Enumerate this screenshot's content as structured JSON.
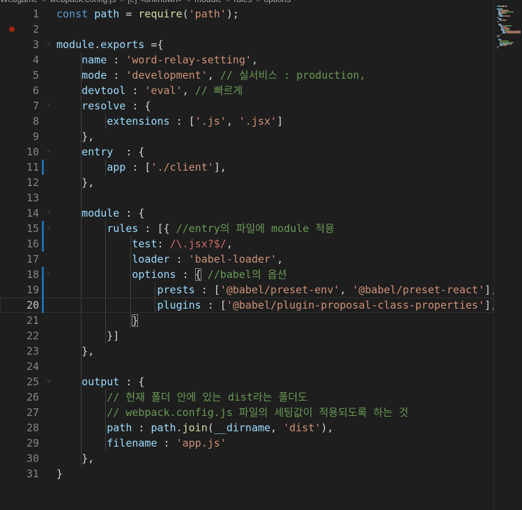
{
  "breadcrumb": {
    "items": [
      "Webgame",
      "webpack.config.js",
      "[e] <unknown>",
      "module",
      "rules",
      "options"
    ],
    "separator": ">"
  },
  "editor": {
    "language": "javascript",
    "active_line": "20",
    "breakpoint_line": "2",
    "lines": [
      {
        "n": "1",
        "tokens": [
          [
            "kw",
            "const"
          ],
          [
            "pun",
            " "
          ],
          [
            "var",
            "path"
          ],
          [
            "pun",
            " = "
          ],
          [
            "fn",
            "require"
          ],
          [
            "pun",
            "("
          ],
          [
            "str",
            "'path'"
          ],
          [
            "pun",
            ");"
          ]
        ]
      },
      {
        "n": "2",
        "tokens": []
      },
      {
        "n": "3",
        "tokens": [
          [
            "var",
            "module"
          ],
          [
            "pun",
            "."
          ],
          [
            "var",
            "exports"
          ],
          [
            "pun",
            " ={"
          ]
        ]
      },
      {
        "n": "4",
        "tokens": [
          [
            "pun",
            "    "
          ],
          [
            "var",
            "name"
          ],
          [
            "pun",
            " : "
          ],
          [
            "str",
            "'word-relay-setting'"
          ],
          [
            "pun",
            ","
          ]
        ]
      },
      {
        "n": "5",
        "tokens": [
          [
            "pun",
            "    "
          ],
          [
            "var",
            "mode"
          ],
          [
            "pun",
            " : "
          ],
          [
            "str",
            "'development'"
          ],
          [
            "pun",
            ", "
          ],
          [
            "com",
            "// 실서비스 : production,"
          ]
        ]
      },
      {
        "n": "6",
        "tokens": [
          [
            "pun",
            "    "
          ],
          [
            "var",
            "devtool"
          ],
          [
            "pun",
            " : "
          ],
          [
            "str",
            "'eval'"
          ],
          [
            "pun",
            ", "
          ],
          [
            "com",
            "// 빠르게"
          ]
        ]
      },
      {
        "n": "7",
        "tokens": [
          [
            "pun",
            "    "
          ],
          [
            "var",
            "resolve"
          ],
          [
            "pun",
            " : {"
          ]
        ]
      },
      {
        "n": "8",
        "tokens": [
          [
            "pun",
            "        "
          ],
          [
            "var",
            "extensions"
          ],
          [
            "pun",
            " : ["
          ],
          [
            "str",
            "'.js'"
          ],
          [
            "pun",
            ", "
          ],
          [
            "str",
            "'.jsx'"
          ],
          [
            "pun",
            "]"
          ]
        ]
      },
      {
        "n": "9",
        "tokens": [
          [
            "pun",
            "    },"
          ]
        ]
      },
      {
        "n": "10",
        "tokens": [
          [
            "pun",
            "    "
          ],
          [
            "var",
            "entry"
          ],
          [
            "pun",
            "  : {"
          ]
        ]
      },
      {
        "n": "11",
        "tokens": [
          [
            "pun",
            "        "
          ],
          [
            "var",
            "app"
          ],
          [
            "pun",
            " : ["
          ],
          [
            "str",
            "'./client'"
          ],
          [
            "pun",
            "],"
          ]
        ]
      },
      {
        "n": "12",
        "tokens": [
          [
            "pun",
            "    },"
          ]
        ]
      },
      {
        "n": "13",
        "tokens": []
      },
      {
        "n": "14",
        "tokens": [
          [
            "pun",
            "    "
          ],
          [
            "var",
            "module"
          ],
          [
            "pun",
            " : {"
          ]
        ]
      },
      {
        "n": "15",
        "tokens": [
          [
            "pun",
            "        "
          ],
          [
            "var",
            "rules"
          ],
          [
            "pun",
            " : [{ "
          ],
          [
            "com",
            "//entry의 파일에 module 적용"
          ]
        ]
      },
      {
        "n": "16",
        "tokens": [
          [
            "pun",
            "            "
          ],
          [
            "var",
            "test"
          ],
          [
            "pun",
            ": "
          ],
          [
            "re",
            "/\\.jsx?$/"
          ],
          [
            "pun",
            ","
          ]
        ]
      },
      {
        "n": "17",
        "tokens": [
          [
            "pun",
            "            "
          ],
          [
            "var",
            "loader"
          ],
          [
            "pun",
            " : "
          ],
          [
            "str",
            "'babel-loader'"
          ],
          [
            "pun",
            ","
          ]
        ]
      },
      {
        "n": "18",
        "tokens": [
          [
            "pun",
            "            "
          ],
          [
            "var",
            "options"
          ],
          [
            "pun",
            " : "
          ],
          [
            "brk",
            "{"
          ],
          [
            "pun",
            " "
          ],
          [
            "com",
            "//babel의 옵션"
          ]
        ]
      },
      {
        "n": "19",
        "tokens": [
          [
            "pun",
            "                "
          ],
          [
            "var",
            "prests"
          ],
          [
            "pun",
            " : ["
          ],
          [
            "str",
            "'@babel/preset-env'"
          ],
          [
            "pun",
            ", "
          ],
          [
            "str",
            "'@babel/preset-react'"
          ],
          [
            "pun",
            "],"
          ]
        ]
      },
      {
        "n": "20",
        "tokens": [
          [
            "pun",
            "                "
          ],
          [
            "var",
            "plugins"
          ],
          [
            "pun",
            " : ["
          ],
          [
            "str",
            "'@babel/plugin-proposal-class-properties'"
          ],
          [
            "pun",
            "],"
          ]
        ]
      },
      {
        "n": "21",
        "tokens": [
          [
            "pun",
            "            "
          ],
          [
            "brk",
            "}"
          ]
        ]
      },
      {
        "n": "22",
        "tokens": [
          [
            "pun",
            "        }]"
          ]
        ]
      },
      {
        "n": "23",
        "tokens": [
          [
            "pun",
            "    },"
          ]
        ]
      },
      {
        "n": "24",
        "tokens": []
      },
      {
        "n": "25",
        "tokens": [
          [
            "pun",
            "    "
          ],
          [
            "var",
            "output"
          ],
          [
            "pun",
            " : {"
          ]
        ]
      },
      {
        "n": "26",
        "tokens": [
          [
            "pun",
            "        "
          ],
          [
            "com",
            "// 현재 폴더 안에 있는 dist라는 폴더도"
          ]
        ]
      },
      {
        "n": "27",
        "tokens": [
          [
            "pun",
            "        "
          ],
          [
            "com",
            "// webpack.config.js 파일의 세팅값이 적용되도록 하는 것"
          ]
        ]
      },
      {
        "n": "28",
        "tokens": [
          [
            "pun",
            "        "
          ],
          [
            "var",
            "path"
          ],
          [
            "pun",
            " : "
          ],
          [
            "var",
            "path"
          ],
          [
            "pun",
            "."
          ],
          [
            "fn",
            "join"
          ],
          [
            "pun",
            "("
          ],
          [
            "var",
            "__dirname"
          ],
          [
            "pun",
            ", "
          ],
          [
            "str",
            "'dist'"
          ],
          [
            "pun",
            "),"
          ]
        ]
      },
      {
        "n": "29",
        "tokens": [
          [
            "pun",
            "        "
          ],
          [
            "var",
            "filename"
          ],
          [
            "pun",
            " : "
          ],
          [
            "str",
            "'app.js'"
          ]
        ]
      },
      {
        "n": "30",
        "tokens": [
          [
            "pun",
            "    },"
          ]
        ]
      },
      {
        "n": "31",
        "tokens": [
          [
            "pun",
            "}"
          ]
        ]
      }
    ],
    "fold_lines": [
      "3",
      "7",
      "10",
      "14",
      "15",
      "18",
      "25"
    ],
    "modified_lines": [
      "11",
      "15",
      "16",
      "18",
      "19",
      "20"
    ]
  },
  "colors": {
    "background": "#1e1e1e",
    "keyword": "#569cd6",
    "function": "#dcdcaa",
    "variable": "#9cdcfe",
    "string": "#ce9178",
    "comment": "#6a9955",
    "regex": "#d16969",
    "breakpoint": "#a1260d",
    "modified_marker": "#1b6fa8"
  },
  "icons": {
    "breakpoint": "breakpoint-dot-icon",
    "fold": "chevron-down-icon",
    "file": "js-file-icon"
  }
}
